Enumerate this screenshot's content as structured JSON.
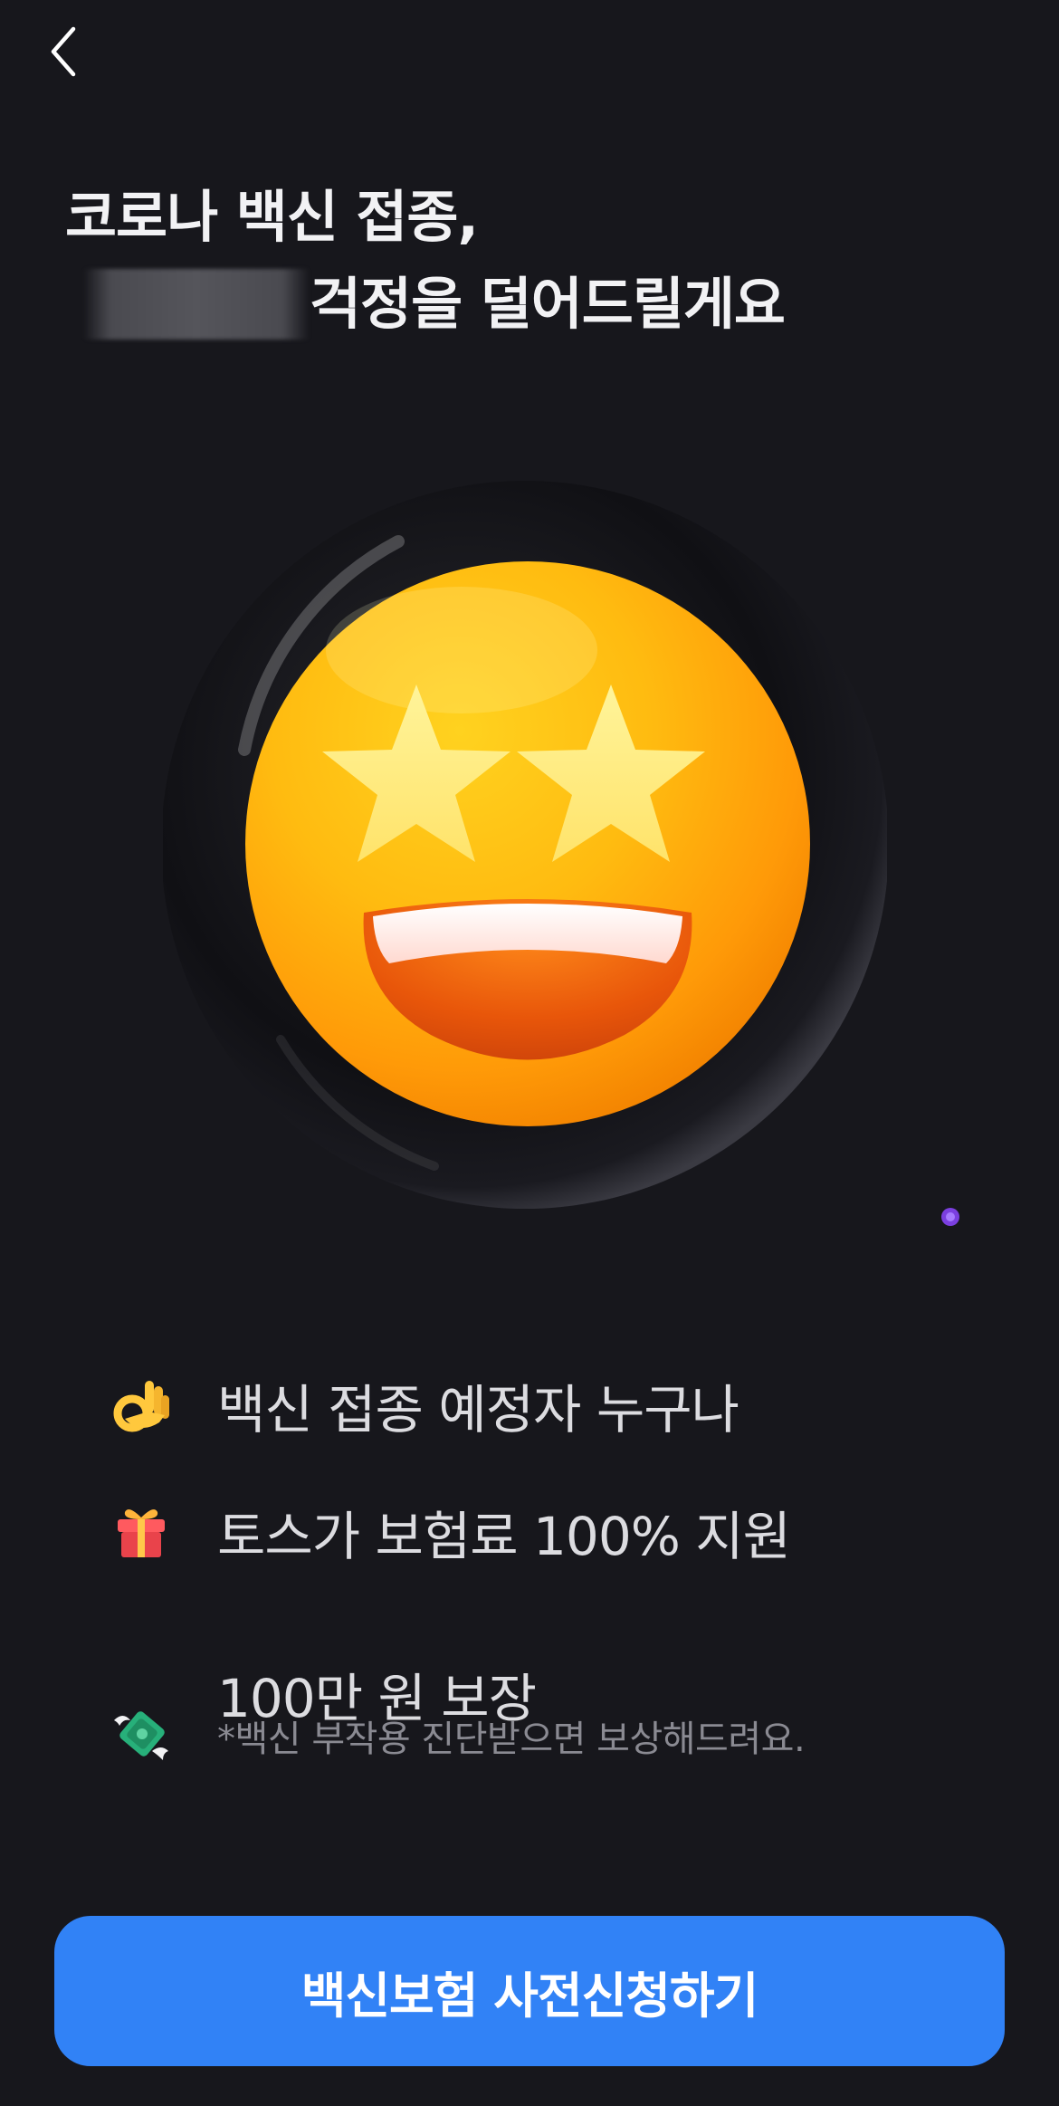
{
  "nav": {
    "back_icon": "chevron-left-icon"
  },
  "headline": {
    "line1": "코로나 백신 접종,",
    "line2": "걱정을 덜어드릴게요"
  },
  "hero": {
    "icon": "star-struck-emoji-icon"
  },
  "features": [
    {
      "icon": "ok-hand-icon",
      "text": "백신 접종 예정자 누구나"
    },
    {
      "icon": "gift-icon",
      "text": "토스가 보험료 100% 지원"
    },
    {
      "icon": "flying-money-icon",
      "text": "100만 원 보장",
      "sub": "*백신 부작용 진단받으면 보상해드려요."
    }
  ],
  "cta": {
    "label": "백신보험 사전신청하기"
  },
  "colors": {
    "background": "#17171c",
    "accent": "#3182f6",
    "text_primary": "#f2f2f4",
    "text_secondary": "#8a8a92"
  }
}
